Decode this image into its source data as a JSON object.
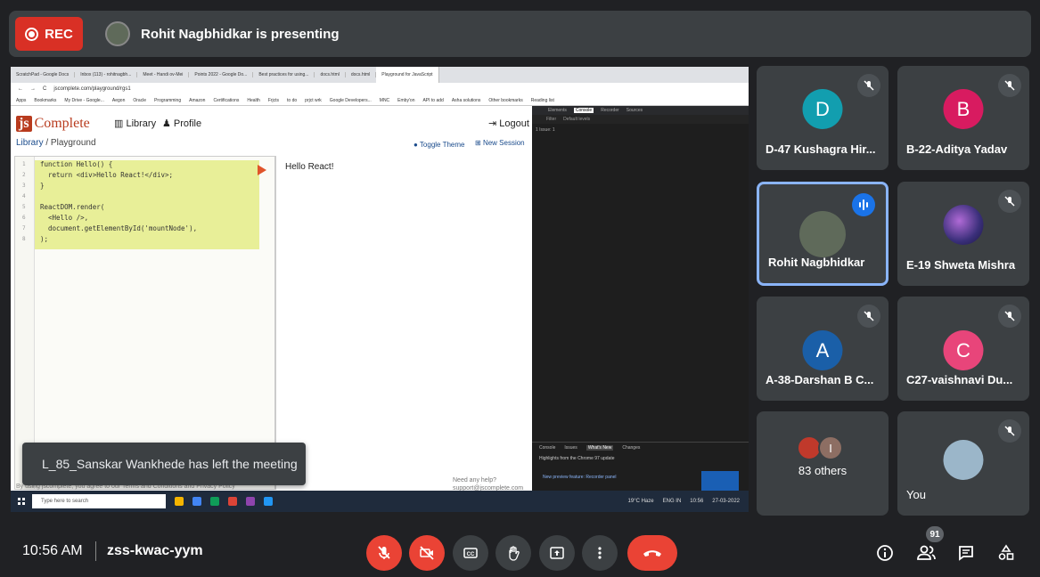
{
  "topbar": {
    "rec_label": "REC",
    "presenting_text": "Rohit Nagbhidkar is presenting"
  },
  "browser": {
    "tabs": [
      "ScratchPad - Google Docs",
      "Inbox (113) - rohitnagbh...",
      "Meet - Handi ov-Mei",
      "Points 2022 - Google Do...",
      "Best practices for using...",
      "docs.html",
      "docs.html",
      "Playground for JavaScript"
    ],
    "address": "jscomplete.com/playground/rgs1",
    "bookmarks": [
      "Apps",
      "Bookmarks",
      "My Drive - Google...",
      "Aegon",
      "Oracle",
      "Programming",
      "Amazon",
      "Certifications",
      "Health",
      "Frjcts",
      "to do",
      "prjct wrk",
      "Google Developers...",
      "MNC",
      "Emby'on",
      "API to add",
      "Asha solutions",
      "Other bookmarks",
      "Reading list"
    ]
  },
  "jsapp": {
    "logo_js": "js",
    "logo_text": "Complete",
    "nav_library": "Library",
    "nav_profile": "Profile",
    "logout": "Logout",
    "breadcrumb_library": "Library",
    "breadcrumb_sep": "/",
    "breadcrumb_page": "Playground",
    "toggle_theme": "Toggle Theme",
    "new_session": "New Session",
    "code_lines": [
      "function Hello() {",
      "  return <div>Hello React!</div>;",
      "}",
      "",
      "ReactDOM.render(",
      "  <Hello />,",
      "  document.getElementById('mountNode'),",
      ");"
    ],
    "line_numbers": [
      "1",
      "2",
      "3",
      "4",
      "5",
      "6",
      "7",
      "8"
    ],
    "preview_output": "Hello React!",
    "help_line1": "Need any help?",
    "help_line2": "support@jscomplete.com",
    "terms": "By using jscomplete, you agree to our Terms and Conditions and Privacy Policy"
  },
  "devtools": {
    "tabs": [
      "Elements",
      "Console",
      "Recorder",
      "Sources"
    ],
    "active_tab": "Console",
    "filter_placeholder": "Filter",
    "levels": "Default levels",
    "issues": "1 Issue: 1",
    "drawer_tabs": [
      "Console",
      "Issues",
      "What's New",
      "Changes"
    ],
    "drawer_highlight": "Highlights from the Chrome 97 update",
    "drawer_feature": "New preview feature: Recorder panel"
  },
  "taskbar": {
    "search_placeholder": "Type here to search",
    "weather": "19°C Haze",
    "lang": "ENG IN",
    "clock": "10:56",
    "date": "27-03-2022"
  },
  "toast": "L_85_Sanskar Wankhede has left the meeting",
  "participants": [
    {
      "name": "D-47 Kushagra Hir...",
      "initial": "D",
      "color": "#129eaf",
      "muted": true
    },
    {
      "name": "B-22-Aditya Yadav",
      "initial": "B",
      "color": "#d81b60",
      "muted": true
    },
    {
      "name": "Rohit Nagbhidkar",
      "initial": "",
      "color": "#5f6a5a",
      "muted": false,
      "speaking": true
    },
    {
      "name": "E-19 Shweta Mishra",
      "initial": "",
      "color": "#3a2f7a",
      "muted": true
    },
    {
      "name": "A-38-Darshan B C...",
      "initial": "A",
      "color": "#1a5fa8",
      "muted": true
    },
    {
      "name": "C27-vaishnavi Du...",
      "initial": "C",
      "color": "#e8457a",
      "muted": true
    },
    {
      "name": "83 others",
      "initial": "I",
      "color": "#8d6e63",
      "muted": false
    },
    {
      "name": "You",
      "initial": "",
      "color": "#9bb6c9",
      "muted": true
    }
  ],
  "bottombar": {
    "time": "10:56 AM",
    "meeting_code": "zss-kwac-yym",
    "people_count": "91"
  },
  "colors": {
    "background": "#202124",
    "tile": "#3c4043",
    "danger": "#ea4335",
    "accent": "#8ab4f8"
  }
}
